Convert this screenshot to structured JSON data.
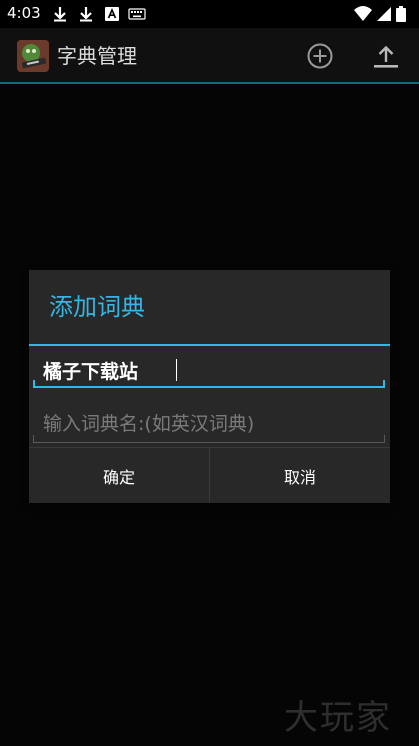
{
  "status_bar": {
    "time": "4:03",
    "icons": [
      "download-icon",
      "download-icon",
      "a-box-icon",
      "keyboard-icon"
    ],
    "right_icons": [
      "wifi-icon",
      "signal-icon",
      "battery-icon"
    ]
  },
  "action_bar": {
    "title": "字典管理",
    "app_icon": "app-logo-icon",
    "actions": [
      "add-circle-icon",
      "upload-icon"
    ]
  },
  "dialog": {
    "title": "添加词典",
    "name_value": "橘子下载站",
    "name_placeholder": "",
    "dict_placeholder": "输入词典名:(如英汉词典)",
    "confirm_label": "确定",
    "cancel_label": "取消"
  },
  "colors": {
    "accent": "#33b5e5",
    "dialog_bg": "#282828",
    "background": "#050505"
  },
  "watermark": "大玩家"
}
